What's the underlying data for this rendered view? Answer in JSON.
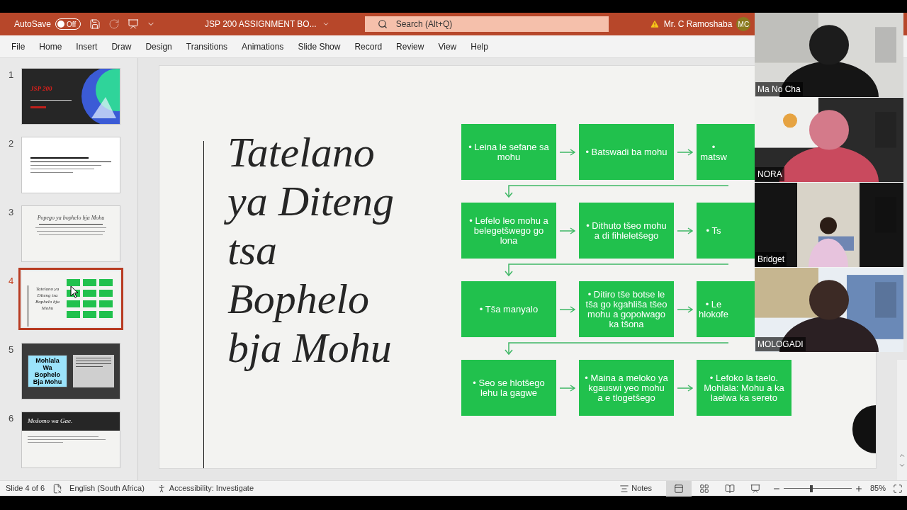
{
  "title_bar": {
    "autosave_label": "AutoSave",
    "autosave": {
      "on": false,
      "label": "Off"
    },
    "document_title": "JSP 200 ASSIGNMENT BO...",
    "search_placeholder": "Search (Alt+Q)",
    "user_name": "Mr. C Ramoshaba",
    "user_initials": "MC"
  },
  "ribbon_tabs": [
    "File",
    "Home",
    "Insert",
    "Draw",
    "Design",
    "Transitions",
    "Animations",
    "Slide Show",
    "Record",
    "Review",
    "View",
    "Help"
  ],
  "thumbnails": [
    {
      "number": "1",
      "selected": false,
      "kind": "title-dark",
      "title": "JSP 200"
    },
    {
      "number": "2",
      "selected": false,
      "kind": "text-white"
    },
    {
      "number": "3",
      "selected": false,
      "kind": "heading-light",
      "title": "Popego ya bophelo bja Mohu"
    },
    {
      "number": "4",
      "selected": true,
      "kind": "flow",
      "title": "Tatelano ya Diteng tsa Bophelo bja Mohu"
    },
    {
      "number": "5",
      "selected": false,
      "kind": "split-dark",
      "title": "Mohlala Wa Bophelo Bja Mohu"
    },
    {
      "number": "6",
      "selected": false,
      "kind": "banner",
      "title": "Mošomo wa Gae."
    }
  ],
  "slide": {
    "title_lines": [
      "Tatelano",
      "ya Diteng",
      "tsa",
      "Bophelo",
      "bja Mohu"
    ],
    "flow_rows": [
      [
        {
          "kind": "box",
          "text": "• Leina le sefane sa mohu"
        },
        {
          "kind": "box",
          "text": "• Batswadi ba mohu"
        },
        {
          "kind": "cut",
          "text": "• matsw"
        }
      ],
      [
        {
          "kind": "box",
          "text": "• Lefelo leo mohu a belegetšwego go lona"
        },
        {
          "kind": "box",
          "text": "• Dithuto tšeo mohu a di fihleletšego"
        },
        {
          "kind": "cut",
          "text": "• Ts"
        }
      ],
      [
        {
          "kind": "box",
          "text": "• Tša manyalo"
        },
        {
          "kind": "box",
          "text": "• Ditiro tše botse le tša go kgahliša tšeo mohu a gopolwago ka tšona"
        },
        {
          "kind": "cut",
          "text": "• Le hlokofe"
        }
      ],
      [
        {
          "kind": "box",
          "text": "• Seo se hlotšego lehu la gagwe"
        },
        {
          "kind": "box",
          "text": "• Maina a meloko ya kgauswi yeo mohu a e tlogetšego"
        },
        {
          "kind": "box",
          "text": "• Lefoko la taelo. Mohlala: Mohu a ka laelwa ka sereto"
        }
      ]
    ]
  },
  "participants": [
    {
      "name": "Ma No Cha"
    },
    {
      "name": "NORA"
    },
    {
      "name": "Bridget"
    },
    {
      "name": "MOLOGADI"
    }
  ],
  "status_bar": {
    "slide_indicator": "Slide 4 of 6",
    "language": "English (South Africa)",
    "accessibility": "Accessibility: Investigate",
    "notes": "Notes",
    "view_buttons": [
      {
        "kind": "normal",
        "selected": true
      },
      {
        "kind": "sorter",
        "selected": false
      },
      {
        "kind": "reading",
        "selected": false
      },
      {
        "kind": "slideshow",
        "selected": false
      }
    ],
    "zoom": {
      "level": 0.41,
      "label": "85%"
    }
  }
}
